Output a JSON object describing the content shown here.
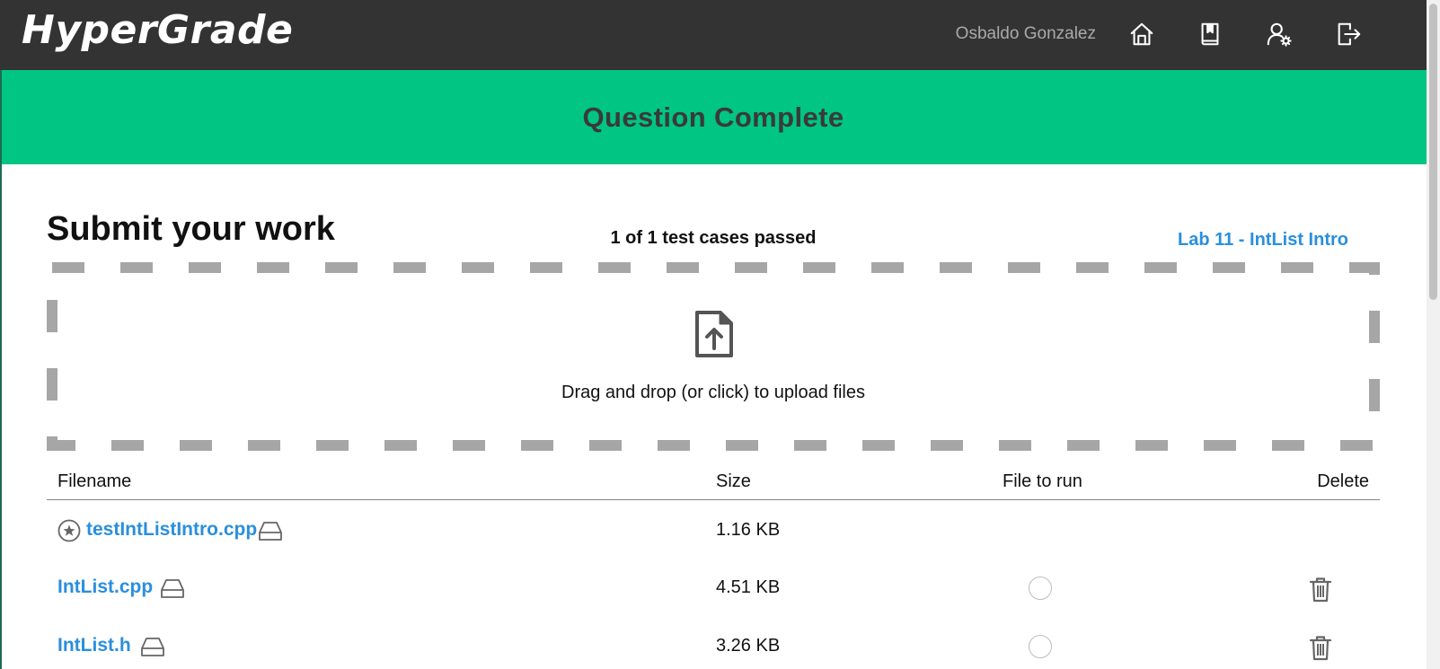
{
  "header": {
    "logo": "HyperGrade",
    "username": "Osbaldo Gonzalez",
    "nav_icons": [
      "home-icon",
      "book-icon",
      "user-settings-icon",
      "logout-icon"
    ]
  },
  "banner": {
    "title": "Question Complete",
    "color": "#00c583"
  },
  "main": {
    "title": "Submit your work",
    "status": "1 of 1 test cases passed",
    "lab_link": "Lab 11 - IntList Intro",
    "dropzone_text": "Drag and drop (or click) to upload files"
  },
  "table": {
    "headers": {
      "filename": "Filename",
      "size": "Size",
      "file_to_run": "File to run",
      "delete": "Delete"
    },
    "rows": [
      {
        "name": "testIntListIntro.cpp",
        "size": "1.16 KB",
        "starred": true,
        "runnable": false,
        "deletable": false
      },
      {
        "name": "IntList.cpp",
        "size": "4.51 KB",
        "starred": false,
        "runnable": true,
        "deletable": true
      },
      {
        "name": "IntList.h",
        "size": "3.26 KB",
        "starred": false,
        "runnable": true,
        "deletable": true
      }
    ]
  },
  "colors": {
    "header_bg": "#333333",
    "accent_link": "#2a8fdc",
    "dash": "#a6a6a6"
  }
}
